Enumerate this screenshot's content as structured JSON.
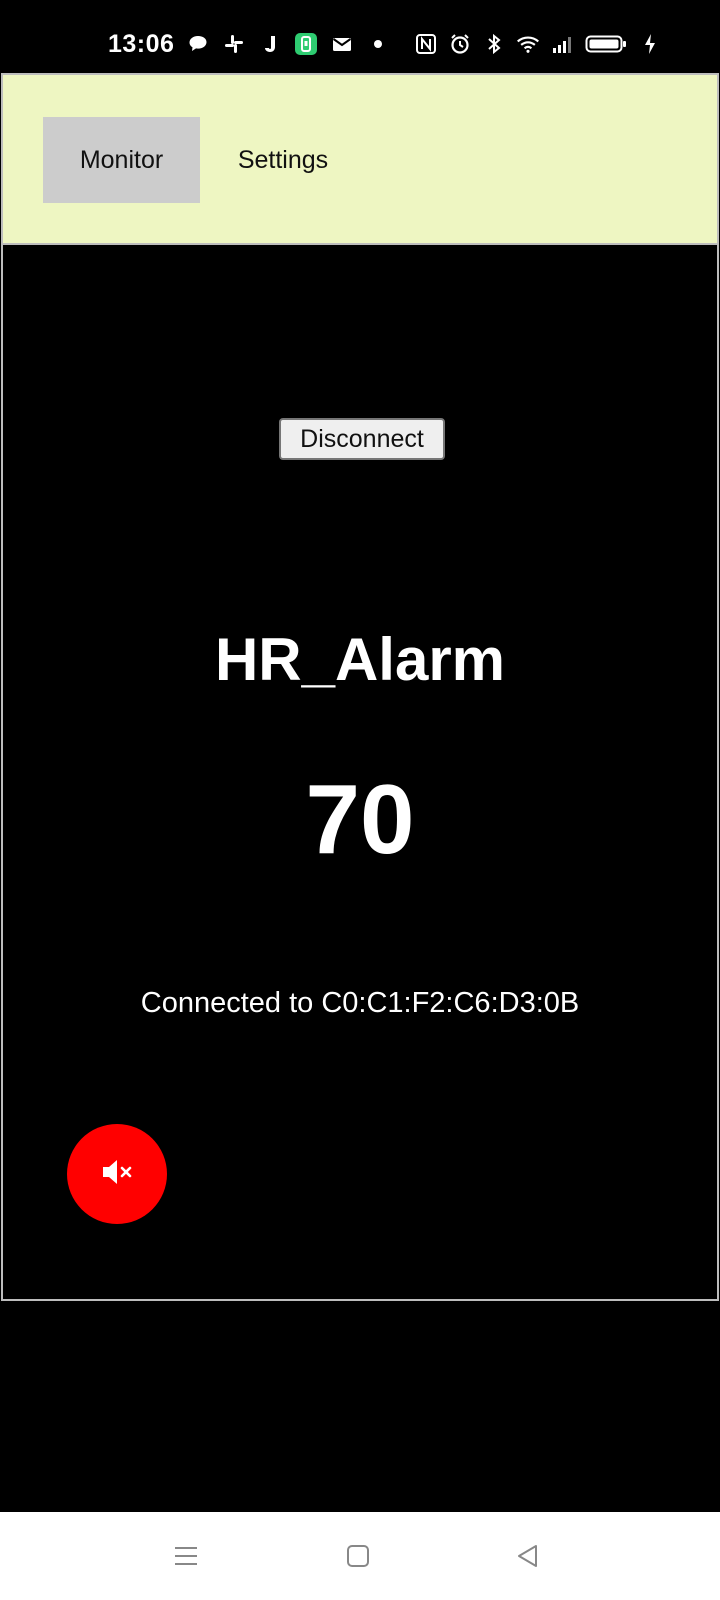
{
  "status_bar": {
    "time": "13:06",
    "left_icons": [
      "chat-bubble-icon",
      "slack-icon",
      "j-app-icon",
      "green-app-icon",
      "mail-icon",
      "dot-icon"
    ],
    "right_icons": [
      "nfc-icon",
      "alarm-icon",
      "bluetooth-icon",
      "wifi-icon",
      "signal-icon",
      "battery-icon",
      "charging-icon"
    ]
  },
  "tabs": [
    {
      "label": "Monitor",
      "active": true
    },
    {
      "label": "Settings",
      "active": false
    }
  ],
  "monitor": {
    "disconnect_label": "Disconnect",
    "device_name": "HR_Alarm",
    "heart_rate": "70",
    "connection_status": "Connected to C0:C1:F2:C6:D3:0B"
  },
  "mute_button": {
    "icon": "mute-icon",
    "color": "#ff0000"
  },
  "nav_bar": {
    "buttons": [
      "menu-icon",
      "home-icon",
      "back-icon"
    ]
  },
  "colors": {
    "tab_strip_bg": "#eef6c2",
    "active_tab_bg": "#cccccc",
    "screen_bg": "#000000",
    "fab_bg": "#ff0000"
  }
}
